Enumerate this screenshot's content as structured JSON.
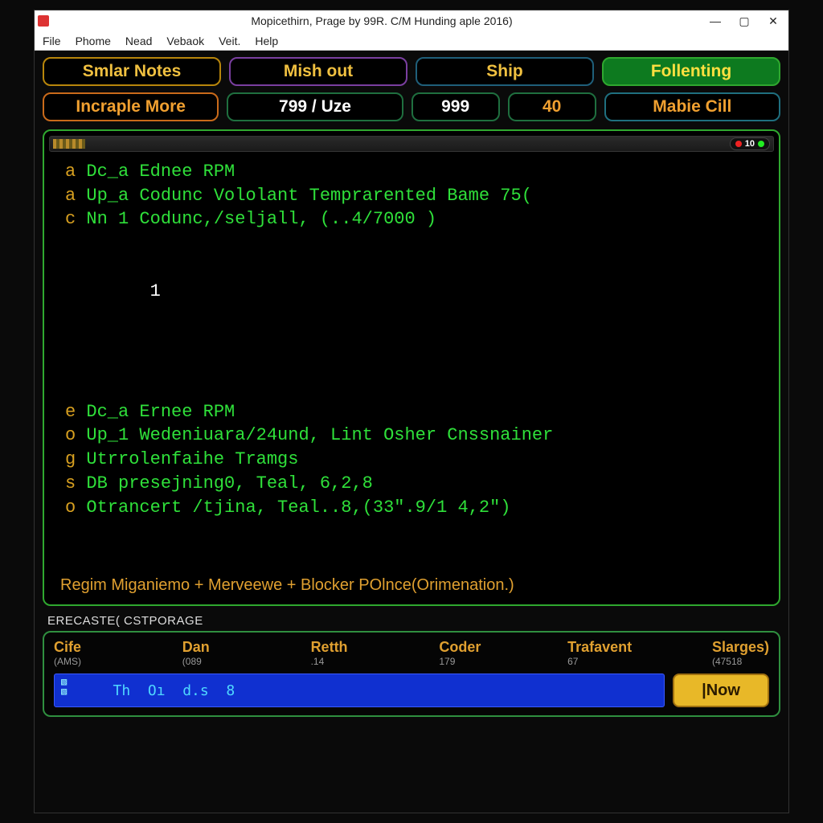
{
  "window": {
    "title": "Mopicethirn, Prage by 99R. C/M Hunding aple 2016)"
  },
  "menu": {
    "items": [
      "File",
      "Phome",
      "Nead",
      "Vebaok",
      "Veit.",
      "Help"
    ]
  },
  "toolbar": {
    "row1": [
      {
        "label": "Smlar Notes"
      },
      {
        "label": "Mish out"
      },
      {
        "label": "Ship"
      },
      {
        "label": "Follenting"
      }
    ],
    "row2": [
      {
        "label": "Incraple More"
      },
      {
        "label": "799 / Uze"
      },
      {
        "label": "999"
      },
      {
        "label": "40"
      },
      {
        "label": "Mabie Cill"
      }
    ]
  },
  "term_indicator": {
    "value": "10"
  },
  "terminal": {
    "block1": [
      {
        "tag": "a",
        "text": "Dc_a Ednee RPM"
      },
      {
        "tag": "a",
        "text": "Up_a Codunc Vololant Temprarented Bame 75("
      },
      {
        "tag": "c",
        "text": "Nn 1 Codunc,/seljall, (..4/7000 )"
      }
    ],
    "cursor_line": "        1",
    "block2": [
      {
        "tag": "e",
        "text": "Dc_a Ernee RPM"
      },
      {
        "tag": "o",
        "text": "Up_1 Wedeniuara/24und, Lint Osher Cnssnainer"
      },
      {
        "tag": "g",
        "text": "Utrrolenfaihe Tramgs"
      },
      {
        "tag": "s",
        "text": "DB presejning0, Teal, 6,2,8"
      },
      {
        "tag": "o",
        "text": "Otrancert /tjina, Teal..8,(33\".9/1 4,2\")"
      }
    ],
    "footer": "Regim Miganiemo + Merveewe + Blocker POlnce(Orimenation.)"
  },
  "storage": {
    "label": "ERECASTE( CSTPORAGE",
    "cols": [
      {
        "head": "Cife",
        "val": "(AMS)"
      },
      {
        "head": "Dan",
        "val": "(089"
      },
      {
        "head": "Retth",
        "val": ".14"
      },
      {
        "head": "Coder",
        "val": "179"
      },
      {
        "head": "Trafavent",
        "val": "67"
      },
      {
        "head": "Slarges)",
        "val": "(47518"
      }
    ],
    "bluebar": "   Th  Oı  d.s  8",
    "now": "|Now"
  }
}
